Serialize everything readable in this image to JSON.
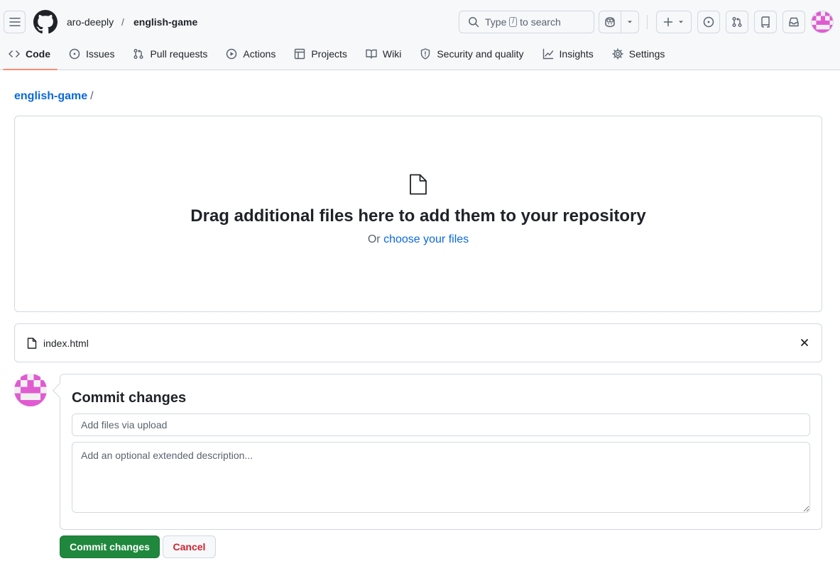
{
  "header": {
    "owner": "aro-deeply",
    "separator": "/",
    "repo": "english-game",
    "search_prefix": "Type",
    "search_key": "/",
    "search_suffix": "to search"
  },
  "nav": {
    "items": [
      {
        "label": "Code",
        "icon": "code-icon",
        "active": true
      },
      {
        "label": "Issues",
        "icon": "issue-icon"
      },
      {
        "label": "Pull requests",
        "icon": "pull-request-icon"
      },
      {
        "label": "Actions",
        "icon": "play-icon"
      },
      {
        "label": "Projects",
        "icon": "table-icon"
      },
      {
        "label": "Wiki",
        "icon": "book-icon"
      },
      {
        "label": "Security and quality",
        "icon": "shield-icon"
      },
      {
        "label": "Insights",
        "icon": "graph-icon"
      },
      {
        "label": "Settings",
        "icon": "gear-icon"
      }
    ]
  },
  "breadcrumb": {
    "repo": "english-game",
    "sep": "/"
  },
  "dropzone": {
    "title": "Drag additional files here to add them to your repository",
    "or_text": "Or",
    "choose_link": "choose your files"
  },
  "file": {
    "name": "index.html"
  },
  "commit": {
    "title": "Commit changes",
    "summary_placeholder": "Add files via upload",
    "description_placeholder": "Add an optional extended description...",
    "commit_button": "Commit changes",
    "cancel_button": "Cancel"
  },
  "colors": {
    "accent_link": "#0969da",
    "commit_green": "#1f883d",
    "cancel_red": "#d1242f",
    "tab_underline": "#fd8c73",
    "avatar_pink": "#e05bd2"
  }
}
